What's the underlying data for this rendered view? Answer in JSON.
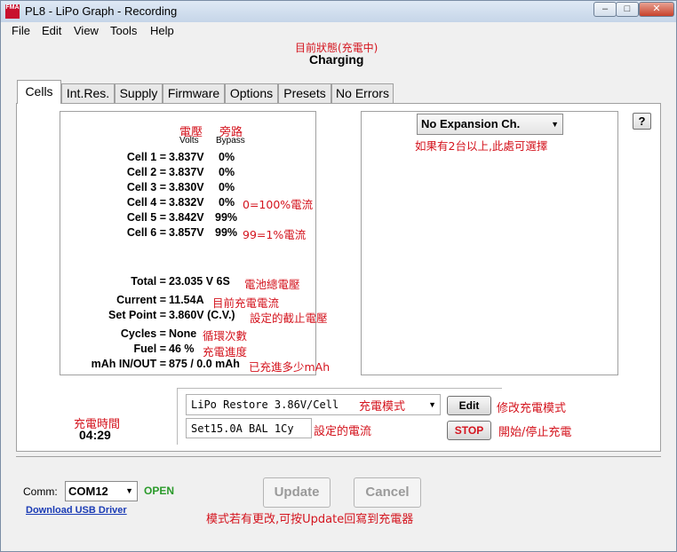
{
  "window": {
    "title": "PL8 - LiPo Graph - Recording",
    "icon_text": "FMA",
    "controls": {
      "minimize": "–",
      "maximize": "□",
      "close": "✕"
    }
  },
  "menu": [
    "File",
    "Edit",
    "View",
    "Tools",
    "Help"
  ],
  "status": {
    "annotation": "目前狀態(充電中)",
    "value": "Charging"
  },
  "tabs": [
    "Cells",
    "Int.Res.",
    "Supply",
    "Firmware",
    "Options",
    "Presets",
    "No Errors"
  ],
  "cells_panel": {
    "header_volts_cn": "電壓",
    "header_bypass_cn": "旁路",
    "header_volts": "Volts",
    "header_bypass": "Bypass",
    "rows": [
      {
        "label": "Cell 1 =",
        "voltage": "3.837V",
        "bypass": "0%",
        "note": ""
      },
      {
        "label": "Cell 2 =",
        "voltage": "3.837V",
        "bypass": "0%",
        "note": ""
      },
      {
        "label": "Cell 3 =",
        "voltage": "3.830V",
        "bypass": "0%",
        "note": ""
      },
      {
        "label": "Cell 4 =",
        "voltage": "3.832V",
        "bypass": "0%",
        "note": "0=100%電流"
      },
      {
        "label": "Cell 5 =",
        "voltage": "3.842V",
        "bypass": "99%",
        "note": ""
      },
      {
        "label": "Cell 6 =",
        "voltage": "3.857V",
        "bypass": "99%",
        "note": "99=1%電流"
      }
    ],
    "stats": [
      {
        "label": "Total =",
        "value": "23.035 V  6S",
        "note": "電池總電壓"
      },
      {
        "label": "Current =",
        "value": "11.54A",
        "note": "目前充電電流"
      },
      {
        "label": "Set Point =",
        "value": "3.860V  (C.V.)",
        "note": "設定的截止電壓"
      },
      {
        "label": "Cycles =",
        "value": "None",
        "note": "循環次數"
      },
      {
        "label": "Fuel =",
        "value": "46 %",
        "note": "充電進度"
      },
      {
        "label": "mAh IN/OUT =",
        "value": "875 / 0.0 mAh",
        "note": "已充進多少mAh"
      }
    ]
  },
  "expansion": {
    "selected": "No Expansion Ch.",
    "note": "如果有2台以上,此處可選擇",
    "help": "?"
  },
  "timer": {
    "label": "充電時間",
    "value": "04:29"
  },
  "mode": {
    "selected": "LiPo Restore 3.86V/Cell",
    "mode_note": "充電模式",
    "edit_label": "Edit",
    "edit_note": "修改充電模式",
    "setting": "Set15.0A BAL 1Cy",
    "setting_note": "設定的電流",
    "stop_label": "STOP",
    "stop_note": "開始/停止充電"
  },
  "bottom": {
    "comm_label": "Comm:",
    "comm_value": "COM12",
    "comm_status": "OPEN",
    "driver_link": "Download USB Driver",
    "update_label": "Update",
    "cancel_label": "Cancel",
    "note": "模式若有更改,可按Update回寫到充電器"
  },
  "colors": {
    "annotation": "#d4141e",
    "open": "#2a9a2a",
    "stop": "#d4141e",
    "link": "#1a3bb5"
  }
}
